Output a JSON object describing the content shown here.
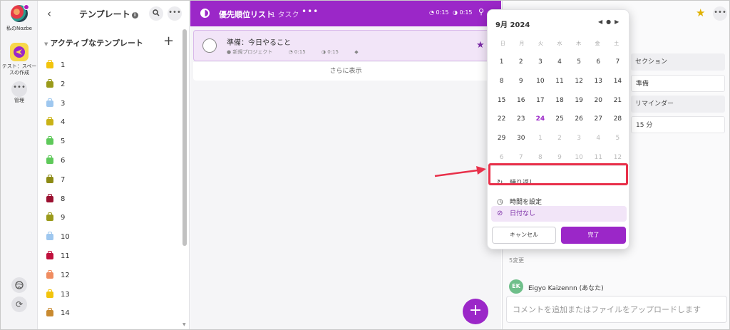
{
  "rail": {
    "my_nozbe": "私のNozbe",
    "space_label": "テスト：スペースの作成",
    "manage": "管理"
  },
  "templates": {
    "title": "テンプレート",
    "section": "アクティブなテンプレート",
    "items": [
      {
        "label": "1",
        "color": "#f2c40c"
      },
      {
        "label": "2",
        "color": "#9a9a1a"
      },
      {
        "label": "3",
        "color": "#9ec7ef"
      },
      {
        "label": "4",
        "color": "#c9b216"
      },
      {
        "label": "5",
        "color": "#5ec95a"
      },
      {
        "label": "6",
        "color": "#5ec95a"
      },
      {
        "label": "7",
        "color": "#8c8a14"
      },
      {
        "label": "8",
        "color": "#9b1030"
      },
      {
        "label": "9",
        "color": "#9a9a1a"
      },
      {
        "label": "10",
        "color": "#9ec7ef"
      },
      {
        "label": "11",
        "color": "#c0103c"
      },
      {
        "label": "12",
        "color": "#f08c60"
      },
      {
        "label": "13",
        "color": "#f2c40c"
      },
      {
        "label": "14",
        "color": "#c98a30"
      }
    ]
  },
  "main": {
    "title": "優先順位リスト",
    "count": "1 タスク",
    "time1": "0:15",
    "time2": "0:15",
    "task": {
      "name": "準備：今日やること",
      "project": "新規プロジェクト",
      "t1": "0:15",
      "t2": "0:15"
    },
    "show_more": "さらに表示"
  },
  "detail": {
    "rows": [
      "セクション",
      "準備",
      "リマインダー",
      "15 分"
    ],
    "changes": "5変更",
    "user_initials": "EK",
    "user": "Eigyo Kaizennn (あなた)",
    "comment_placeholder": "コメントを追加またはファイルをアップロードします"
  },
  "picker": {
    "month": "9月 2024",
    "weekdays": [
      "日",
      "月",
      "火",
      "水",
      "木",
      "金",
      "土"
    ],
    "days": [
      [
        "1",
        "2",
        "3",
        "4",
        "5",
        "6",
        "7"
      ],
      [
        "8",
        "9",
        "10",
        "11",
        "12",
        "13",
        "14"
      ],
      [
        "15",
        "16",
        "17",
        "18",
        "19",
        "20",
        "21"
      ],
      [
        "22",
        "23",
        "24",
        "25",
        "26",
        "27",
        "28"
      ],
      [
        "29",
        "30",
        "1",
        "2",
        "3",
        "4",
        "5"
      ],
      [
        "6",
        "7",
        "8",
        "9",
        "10",
        "11",
        "12"
      ]
    ],
    "today": "24",
    "repeat": "繰り返し",
    "set_time": "時間を設定",
    "no_date": "日付なし",
    "cancel": "キャンセル",
    "done": "完了"
  },
  "colors": {
    "accent": "#9b27c8",
    "highlight": "#e8304a"
  }
}
